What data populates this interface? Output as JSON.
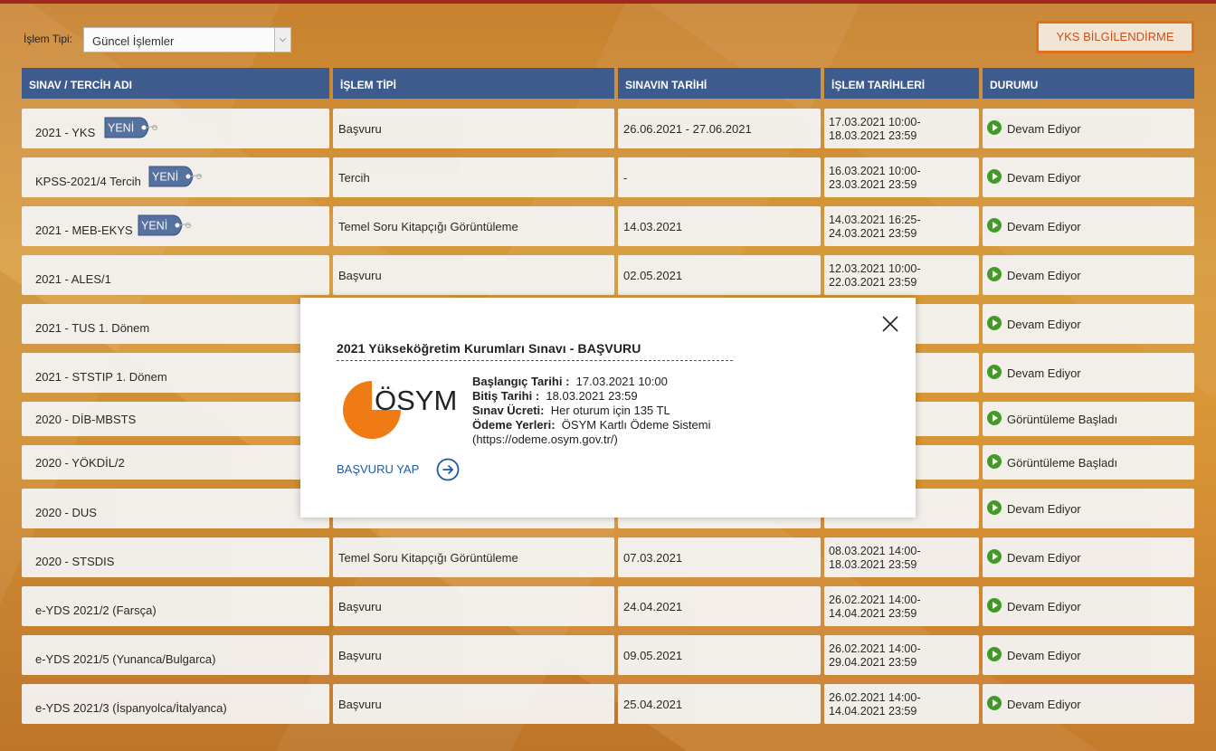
{
  "filter": {
    "label": "İşlem Tipi:",
    "selected": "Güncel İşlemler"
  },
  "yks_button_label": "YKS BİLGİLENDİRME",
  "table": {
    "headers": [
      "SINAV / TERCİH ADI",
      "İŞLEM TİPİ",
      "SINAVIN TARİHİ",
      "İŞLEM TARİHLERİ",
      "DURUMU"
    ],
    "new_badge_text": "YENİ",
    "rows": [
      {
        "name": "2021 - YKS",
        "type": "Başvuru",
        "exam_date": "26.06.2021 - 27.06.2021",
        "date1": "17.03.2021 10:00-",
        "date2": "18.03.2021 23:59",
        "status": "Devam Ediyor",
        "is_new": true
      },
      {
        "name": "KPSS-2021/4 Tercih",
        "type": "Tercih",
        "exam_date": "-",
        "date1": "16.03.2021 10:00-",
        "date2": "23.03.2021 23:59",
        "status": "Devam Ediyor",
        "is_new": true
      },
      {
        "name": "2021 - MEB-EKYS",
        "type": "Temel Soru Kitapçığı Görüntüleme",
        "exam_date": "14.03.2021",
        "date1": "14.03.2021 16:25-",
        "date2": "24.03.2021 23:59",
        "status": "Devam Ediyor",
        "is_new": true
      },
      {
        "name": "2021 - ALES/1",
        "type": "Başvuru",
        "exam_date": "02.05.2021",
        "date1": "12.03.2021 10:00-",
        "date2": "22.03.2021 23:59",
        "status": "Devam Ediyor",
        "is_new": false
      },
      {
        "name": "2021 - TUS 1. Dönem",
        "type": "",
        "exam_date": "",
        "date1": "",
        "date2": "",
        "status": "Devam Ediyor",
        "is_new": false
      },
      {
        "name": "2021 - STSTIP 1. Dönem",
        "type": "",
        "exam_date": "",
        "date1": "",
        "date2": "",
        "status": "Devam Ediyor",
        "is_new": false
      },
      {
        "name": "2020 - DİB-MBSTS",
        "type": "",
        "exam_date": "",
        "date1": "",
        "date2": "",
        "status": "Görüntüleme Başladı",
        "is_new": false
      },
      {
        "name": "2020 - YÖKDİL/2",
        "type": "",
        "exam_date": "",
        "date1": "",
        "date2": "",
        "status": "Görüntüleme Başladı",
        "is_new": false
      },
      {
        "name": "2020 - DUS",
        "type": "",
        "exam_date": "",
        "date1": "",
        "date2": "",
        "status": "Devam Ediyor",
        "is_new": false
      },
      {
        "name": "2020 - STSDIS",
        "type": "Temel Soru Kitapçığı Görüntüleme",
        "exam_date": "07.03.2021",
        "date1": "08.03.2021 14:00-",
        "date2": "18.03.2021 23:59",
        "status": "Devam Ediyor",
        "is_new": false
      },
      {
        "name": "e-YDS 2021/2 (Farsça)",
        "type": "Başvuru",
        "exam_date": "24.04.2021",
        "date1": "26.02.2021 14:00-",
        "date2": "14.04.2021 23:59",
        "status": "Devam Ediyor",
        "is_new": false
      },
      {
        "name": "e-YDS 2021/5 (Yunanca/Bulgarca)",
        "type": "Başvuru",
        "exam_date": "09.05.2021",
        "date1": "26.02.2021 14:00-",
        "date2": "29.04.2021 23:59",
        "status": "Devam Ediyor",
        "is_new": false
      },
      {
        "name": "e-YDS 2021/3 (İspanyolca/İtalyanca)",
        "type": "Başvuru",
        "exam_date": "25.04.2021",
        "date1": "26.02.2021 14:00-",
        "date2": "14.04.2021 23:59",
        "status": "Devam Ediyor",
        "is_new": false
      }
    ]
  },
  "modal": {
    "title": "2021 Yükseköğretim Kurumları Sınavı - BAŞVURU",
    "logo_text": "ÖSYM",
    "start_label": "Başlangıç Tarihi :",
    "start_value": "17.03.2021 10:00",
    "end_label": "Bitiş Tarihi :",
    "end_value": "18.03.2021 23:59",
    "fee_label": "Sınav Ücreti:",
    "fee_value": "Her oturum için 135 TL",
    "payment_label": "Ödeme Yerleri:",
    "payment_value": "ÖSYM Kartlı Ödeme Sistemi",
    "payment_url": "(https://odeme.osym.gov.tr/)",
    "apply_label": "BAŞVURU YAP"
  },
  "colors": {
    "header_bg": "#3d5c8d",
    "accent_orange": "#e26f1c",
    "status_green": "#3b9a2a",
    "link_blue": "#1e5aa8",
    "logo_orange": "#f07b14"
  },
  "icons": {
    "select_arrow": "chevron-down-icon",
    "status": "play-circle-icon",
    "close": "close-icon",
    "apply": "arrow-right-circle-icon",
    "badge": "new-tag-icon"
  }
}
